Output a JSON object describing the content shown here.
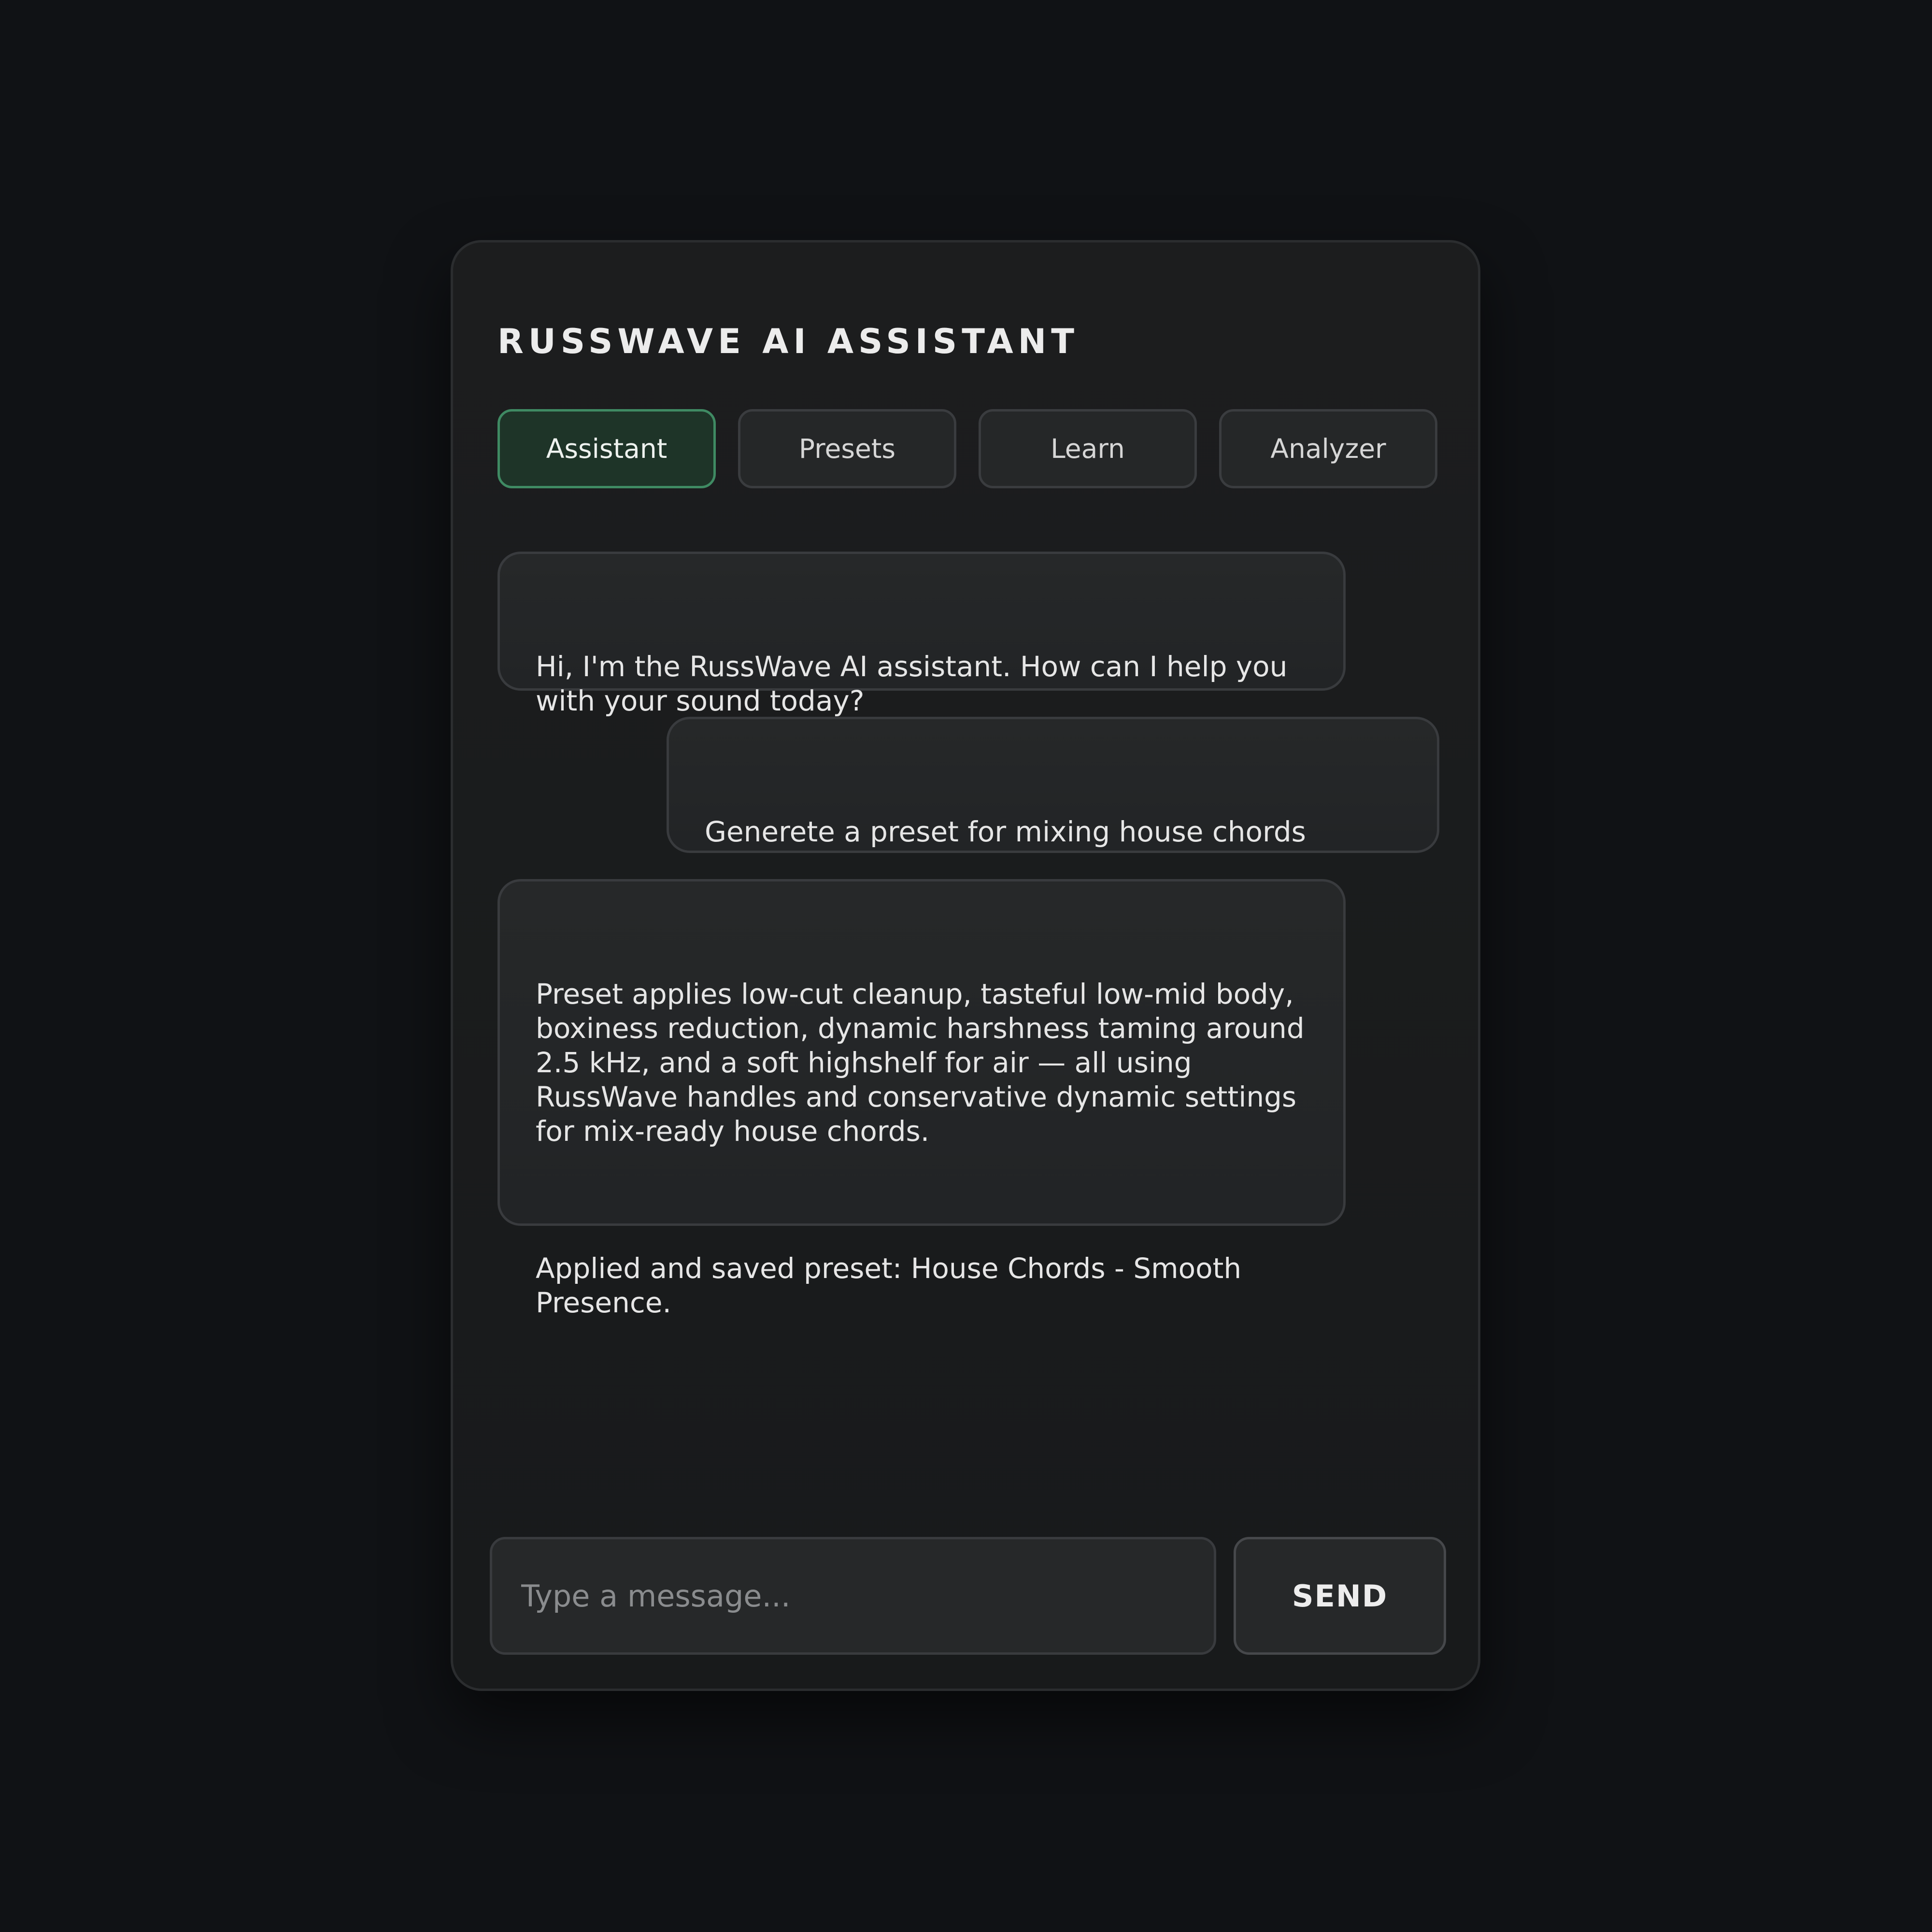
{
  "header": {
    "title": "RUSSWAVE AI ASSISTANT"
  },
  "tabs": [
    {
      "label": "Assistant",
      "active": true
    },
    {
      "label": "Presets",
      "active": false
    },
    {
      "label": "Learn",
      "active": false
    },
    {
      "label": "Analyzer",
      "active": false
    }
  ],
  "messages": [
    {
      "role": "assistant",
      "paragraphs": [
        "Hi, I'm the RussWave AI assistant. How can I help you with your sound today?"
      ]
    },
    {
      "role": "user",
      "paragraphs": [
        "Generete a preset for mixing house chords"
      ]
    },
    {
      "role": "assistant",
      "paragraphs": [
        "Preset applies low-cut cleanup, tasteful low-mid body, boxiness reduction, dynamic harshness taming around 2.5 kHz, and a soft highshelf for air — all using RussWave handles and conservative dynamic settings for mix-ready house chords.",
        "Applied and saved preset: House Chords - Smooth Presence."
      ]
    }
  ],
  "composer": {
    "placeholder": "Type a message...",
    "value": "",
    "send_label": "SEND"
  },
  "colors": {
    "background": "#101215",
    "panel": "#1a1c1d",
    "accent": "#3f8a63",
    "active_tab_bg": "#1e3428"
  }
}
